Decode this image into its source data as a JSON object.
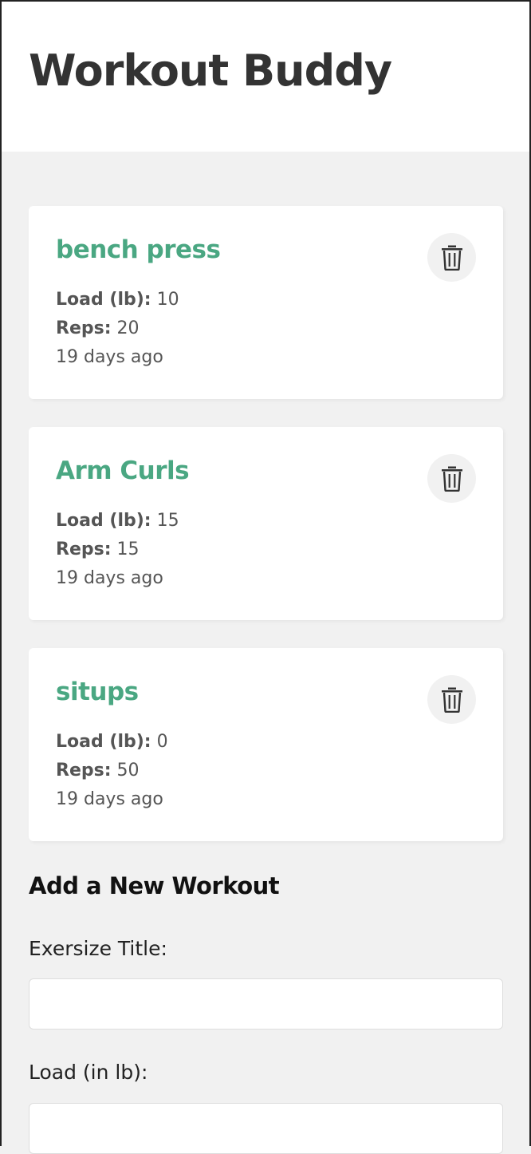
{
  "app": {
    "title": "Workout Buddy"
  },
  "workouts": [
    {
      "title": "bench press",
      "load_label": "Load (lb):",
      "load": "10",
      "reps_label": "Reps:",
      "reps": "20",
      "time": "19 days ago"
    },
    {
      "title": "Arm Curls",
      "load_label": "Load (lb):",
      "load": "15",
      "reps_label": "Reps:",
      "reps": "15",
      "time": "19 days ago"
    },
    {
      "title": "situps",
      "load_label": "Load (lb):",
      "load": "0",
      "reps_label": "Reps:",
      "reps": "50",
      "time": "19 days ago"
    }
  ],
  "form": {
    "heading": "Add a New Workout",
    "title_label": "Exersize Title:",
    "title_value": "",
    "load_label": "Load (in lb):",
    "load_value": ""
  },
  "colors": {
    "accent": "#4aa782",
    "background": "#f1f1f1",
    "card": "#ffffff"
  },
  "icons": {
    "delete": "trash-icon"
  }
}
